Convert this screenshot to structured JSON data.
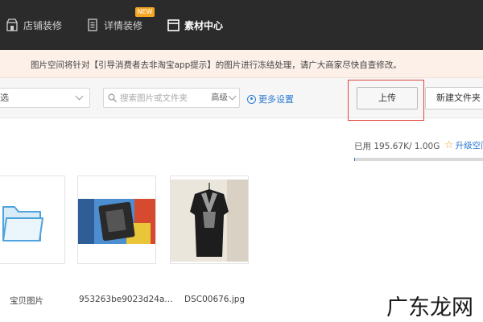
{
  "nav": {
    "items": [
      {
        "label": "店铺装修",
        "icon": "shop-icon"
      },
      {
        "label": "详情装修",
        "icon": "document-icon",
        "badge": "NEW"
      },
      {
        "label": "素材中心",
        "icon": "folder-icon",
        "active": true
      }
    ]
  },
  "notice": {
    "text": "图片空间将针对【引导消费者去非淘宝app提示】的图片进行冻结处理，请广大商家尽快自查修改。"
  },
  "toolbar": {
    "filter_select": "选",
    "search_placeholder": "搜索图片或文件夹",
    "advanced_label": "高级",
    "more_settings_label": "更多设置",
    "upload_label": "上传",
    "new_folder_label": "新建文件夹"
  },
  "storage": {
    "used_text": "已用 195.67K/ 1.00G",
    "upgrade_label": "升级空间",
    "usage_fraction": 0.0002
  },
  "items": [
    {
      "caption": "宝贝图片",
      "type": "folder"
    },
    {
      "caption": "953263be9023d24a...",
      "type": "image"
    },
    {
      "caption": "DSC00676.jpg",
      "type": "image"
    }
  ],
  "watermark": "广东龙网",
  "colors": {
    "accent": "#2a7ad2",
    "highlight": "#e2473e",
    "nav_bg": "#2b2b2b",
    "notice_bg": "#fdf0e8"
  }
}
